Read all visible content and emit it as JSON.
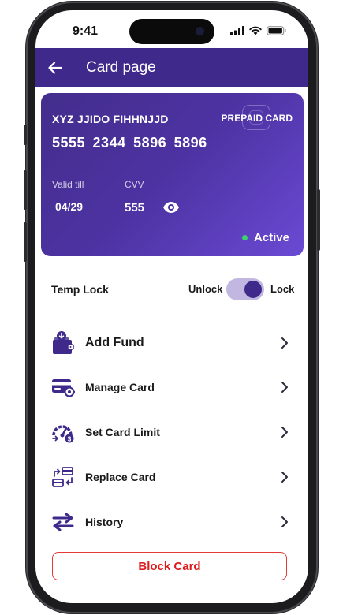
{
  "status_bar": {
    "time": "9:41",
    "icons": [
      "cellular-signal-icon",
      "wifi-icon",
      "battery-icon"
    ]
  },
  "app_bar": {
    "back_icon": "arrow-left-icon",
    "title": "Card page"
  },
  "card": {
    "holder_name": "XYZ JJIDO FIHHNJJD",
    "card_type": "PREPAID CARD",
    "number": "5555 2344 5896 5896",
    "valid_till_label": "Valid till",
    "valid_till": "04/29",
    "cvv_label": "CVV",
    "cvv": "555",
    "status": "Active",
    "status_color": "#3bd16f",
    "gradient": [
      "#432d8c",
      "#6a4ad4"
    ]
  },
  "temp_lock": {
    "label": "Temp Lock",
    "off_label": "Unlock",
    "on_label": "Lock",
    "locked": true
  },
  "menu": [
    {
      "label": "Add Fund",
      "icon": "wallet-download-icon"
    },
    {
      "label": "Manage Card",
      "icon": "card-settings-icon"
    },
    {
      "label": "Set Card Limit",
      "icon": "speedometer-limit-icon"
    },
    {
      "label": "Replace Card",
      "icon": "card-swap-icon"
    },
    {
      "label": "History",
      "icon": "transfer-arrows-icon"
    }
  ],
  "block_button": {
    "label": "Block Card",
    "color": "#e01b1b"
  },
  "colors": {
    "brand": "#3f2a8c",
    "toggle_track": "#c2b7e0"
  }
}
